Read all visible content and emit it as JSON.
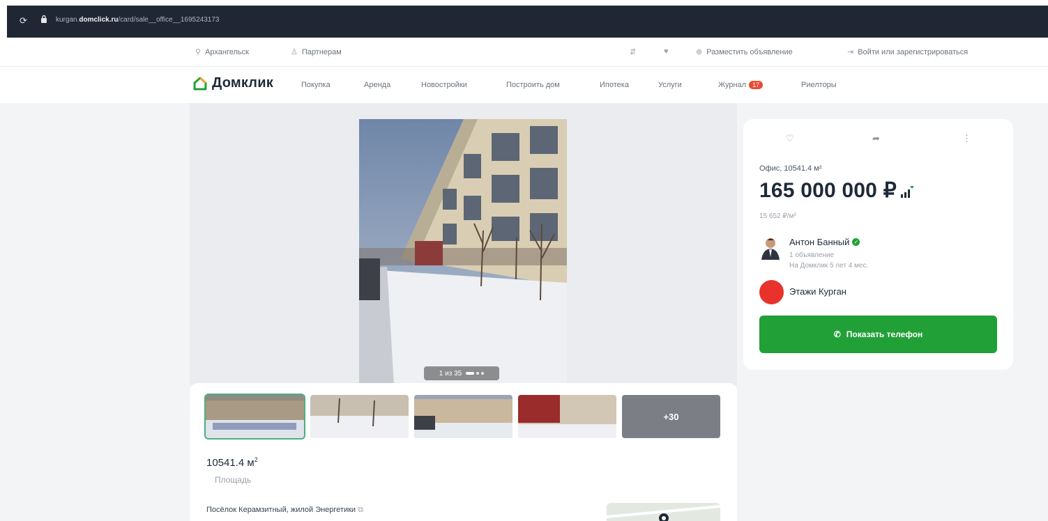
{
  "browser": {
    "url_prefix": "kurgan.",
    "url_domain": "domclick.ru",
    "url_path": "/card/sale__office__1695243173"
  },
  "utility_bar": {
    "city": "Архангельск",
    "partners": "Партнерам",
    "post_ad": "Разместить объявление",
    "login": "Войти или зарегистрироваться"
  },
  "nav": {
    "logo": "Домклик",
    "links": [
      "Покупка",
      "Аренда",
      "Новостройки",
      "Построить дом",
      "Ипотека",
      "Услуги",
      "Журнал",
      "Риелторы"
    ],
    "journal_badge": "17"
  },
  "gallery": {
    "counter": "1 из 35",
    "more_label": "+30"
  },
  "listing": {
    "area_value": "10541.4 м",
    "area_sup": "2",
    "area_label": "Площадь",
    "address": "Посёлок Керамзитный, жилой Энергетики"
  },
  "price_card": {
    "type_line": "Офис, 10541.4 м²",
    "price": "165 000 000 ₽",
    "price_per_m2": "15 652 ₽/м²",
    "agent_name": "Антон Банный",
    "agent_ads": "1 объявление",
    "agent_tenure": "На Домклик 5 лет 4 мес.",
    "agency_name": "Этажи Курган",
    "phone_button": "Показать телефон"
  },
  "colors": {
    "brand_green": "#21a038",
    "badge_red": "#e94b35",
    "browser_dark": "#202633"
  }
}
